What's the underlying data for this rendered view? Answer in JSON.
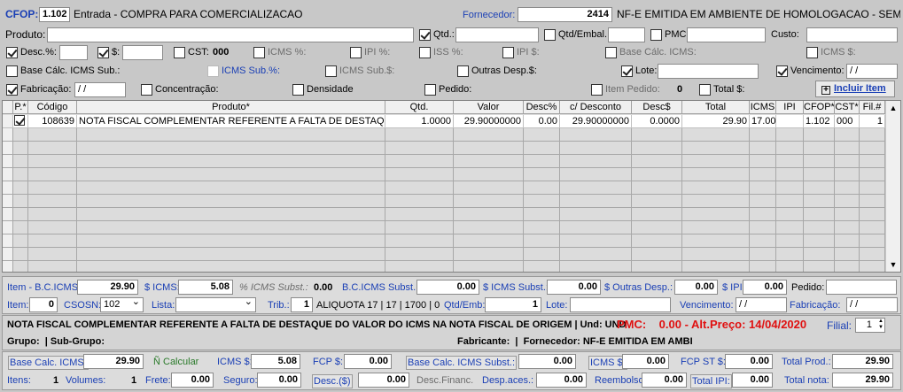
{
  "header": {
    "cfop_label": "CFOP:",
    "cfop_value": "1.102",
    "cfop_desc": "Entrada - COMPRA PARA COMERCIALIZACAO",
    "fornecedor_label": "Fornecedor:",
    "fornecedor_code": "2414",
    "fornecedor_name": "NF-E EMITIDA EM AMBIENTE DE HOMOLOGACAO - SEM V"
  },
  "fields": {
    "produto_label": "Produto:",
    "qtd_label": "Qtd.:",
    "qtd_embal_label": "Qtd/Embal.:",
    "pmc_label": "PMC:",
    "custo_label": "Custo:",
    "desc_pct_label": "Desc.%:",
    "desc_val_label": "$:",
    "cst_label": "CST:",
    "cst_value": "000",
    "icms_pct_label": "ICMS %:",
    "ipi_pct_label": "IPI %:",
    "iss_pct_label": "ISS %:",
    "ipi_val_label": "IPI $:",
    "base_icms_label": "Base Cálc. ICMS:",
    "icms_val_label": "ICMS $:",
    "base_icms_sub_label": "Base Cálc. ICMS Sub.:",
    "icms_sub_pct_label": "ICMS Sub.%:",
    "icms_sub_val_label": "ICMS Sub.$:",
    "outras_desp_label": "Outras Desp.$:",
    "lote_label": "Lote:",
    "vencimento_label": "Vencimento:",
    "vencimento_value": " /  /",
    "fabricacao_label": "Fabricação:",
    "fabricacao_value": " /  /",
    "concentracao_label": "Concentração:",
    "densidade_label": "Densidade",
    "pedido_label": "Pedido:",
    "item_pedido_label": "Item Pedido:",
    "item_pedido_value": "0",
    "total_label": "Total $:",
    "incluir_label": "Incluir Item"
  },
  "grid": {
    "columns": [
      "P.*",
      "Código",
      "Produto*",
      "Qtd.",
      "Valor",
      "Desc%",
      "c/ Desconto",
      "Desc$",
      "Total",
      "ICMS",
      "IPI",
      "CFOP*",
      "CST*",
      "Fil.#"
    ],
    "rows": [
      {
        "codigo": "108639",
        "produto": "NOTA FISCAL COMPLEMENTAR REFERENTE A FALTA DE DESTAQUE D",
        "qtd": "1.0000",
        "valor": "29.90000000",
        "desc_pct": "0.00",
        "c_desconto": "29.90000000",
        "desc_val": "0.0000",
        "total": "29.90",
        "icms": "17.00",
        "ipi": "",
        "cfop": "1.102",
        "cst": "000",
        "fil": "1"
      }
    ]
  },
  "item": {
    "bc_icms_label": "Item - B.C.ICMS:",
    "bc_icms_value": "29.90",
    "icms_val_label": "$ ICMS:",
    "icms_val_value": "5.08",
    "icms_subst_pct_label": "% ICMS Subst.:",
    "icms_subst_pct_value": "0.00",
    "bc_icms_subst_label": "B.C.ICMS Subst.:",
    "bc_icms_subst_value": "0.00",
    "icms_subst_val_label": "$ ICMS Subst.:",
    "icms_subst_val_value": "0.00",
    "outras_desp_label": "$ Outras Desp.:",
    "outras_desp_value": "0.00",
    "ipi_label": "$ IPI:",
    "ipi_value": "0.00",
    "pedido_label": "Pedido:",
    "item_label": "Item:",
    "item_value": "0",
    "csosn_label": "CSOSN:",
    "csosn_value": "102",
    "lista_label": "Lista:",
    "trib_label": "Trib.:",
    "trib_value": "1",
    "aliquota_text": "ALIQUOTA 17 | 17 | 1700 | 0",
    "qtd_emb_label": "Qtd/Emb:",
    "qtd_emb_value": "1",
    "lote_label": "Lote:",
    "vencimento_label": "Vencimento:",
    "vencimento_value": " /  /",
    "fabricacao_label": "Fabricação:",
    "fabricacao_value": " /  /"
  },
  "product_info": {
    "description": "NOTA FISCAL COMPLEMENTAR REFERENTE A FALTA DE DESTAQUE DO VALOR DO ICMS NA NOTA FISCAL DE ORIGEM | Und: UND",
    "pmc_text": "PMC:    0.00 - Alt.Preço: 14/04/2020",
    "filial_label": "Filial:",
    "filial_value": "1",
    "grupo_text": "Grupo:  | Sub-Grupo:",
    "fabricante_text": "Fabricante:  |  Fornecedor: NF-E EMITIDA EM AMBI"
  },
  "totals": {
    "base_icms_label": "Base Calc. ICMS:",
    "base_icms_value": "29.90",
    "calcular_label": "Ñ Calcular",
    "icms_label": "ICMS $:",
    "icms_value": "5.08",
    "fcp_label": "FCP $:",
    "fcp_value": "0.00",
    "base_icms_subst_label": "Base Calc. ICMS Subst.:",
    "base_icms_subst_value": "0.00",
    "icms_subst_label": "ICMS $:",
    "icms_subst_value": "0.00",
    "fcp_st_label": "FCP ST $:",
    "fcp_st_value": "0.00",
    "total_prod_label": "Total Prod.:",
    "total_prod_value": "29.90",
    "itens_label": "Itens:",
    "itens_value": "1",
    "volumes_label": "Volumes:",
    "volumes_value": "1",
    "frete_label": "Frete:",
    "frete_value": "0.00",
    "seguro_label": "Seguro:",
    "seguro_value": "0.00",
    "desc_label": "Desc.($)",
    "desc_value": "0.00",
    "desc_financ_label": "Desc.Financ.",
    "desp_aces_label": "Desp.aces.:",
    "desp_aces_value": "0.00",
    "reembolso_label": "Reembolso:",
    "reembolso_value": "0.00",
    "total_ipi_label": "Total IPI:",
    "total_ipi_value": "0.00",
    "total_nota_label": "Total nota:",
    "total_nota_value": "29.90"
  }
}
